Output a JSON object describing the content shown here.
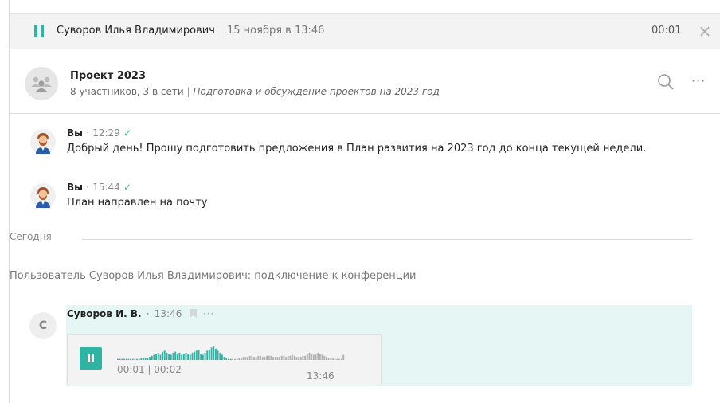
{
  "player_bar": {
    "name": "Суворов Илья Владимирович",
    "date": "15 ноября в 13:46",
    "elapsed": "00:01",
    "close_label": "×"
  },
  "chat": {
    "title": "Проект 2023",
    "members": "8 участников, 3 в сети",
    "separator": "|",
    "description": "Подготовка и обсуждение проектов на 2023 год",
    "more_label": "···"
  },
  "messages": [
    {
      "author": "Вы",
      "dot": "·",
      "time": "12:29",
      "status": "✓",
      "text": "Добрый день! Прошу подготовить предложения в План развития на 2023 год до конца текущей недели."
    },
    {
      "author": "Вы",
      "dot": "·",
      "time": "15:44",
      "status": "✓",
      "text": "План направлен на почту"
    }
  ],
  "day_separator": "Сегодня",
  "system_message": "Пользователь Суворов Илья Владимирович: подключение к конференции",
  "voice_message": {
    "avatar_letter": "С",
    "author": "Суворов И. В.",
    "dot": "·",
    "time": "13:46",
    "more_label": "···",
    "progress": "00:01 | 00:02",
    "sent_time": "13:46",
    "played_fraction": 0.5
  },
  "colors": {
    "accent": "#2fb4a4",
    "voice_bg": "#e6f6f5"
  },
  "icons": [
    "pause-icon",
    "close-icon",
    "group-avatar-icon",
    "search-icon",
    "more-icon",
    "user-avatar-icon",
    "check-icon",
    "bookmark-icon"
  ]
}
